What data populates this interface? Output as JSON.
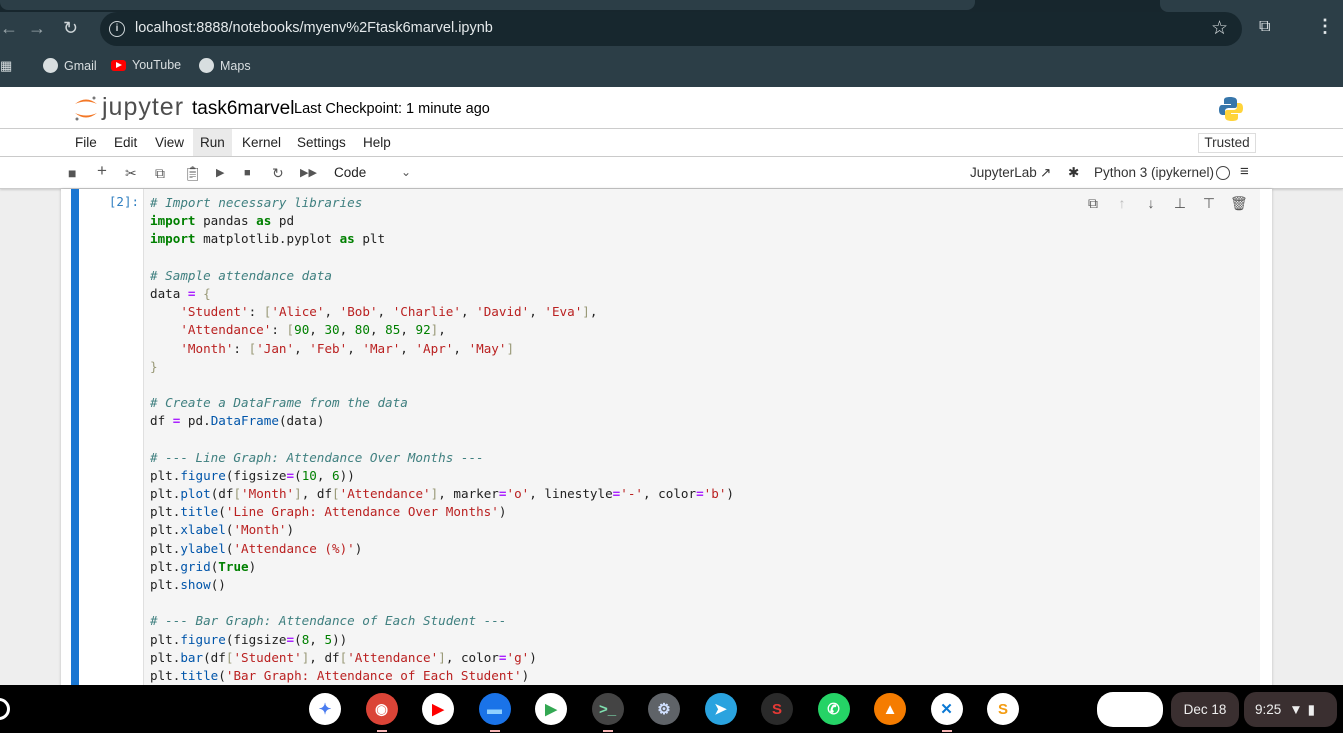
{
  "browser": {
    "url": "localhost:8888/notebooks/myenv%2Ftask6marvel.ipynb",
    "bookmarks": [
      {
        "label": "Gmail",
        "icon": "globe-icon"
      },
      {
        "label": "YouTube",
        "icon": "youtube-icon"
      },
      {
        "label": "Maps",
        "icon": "globe-icon"
      }
    ]
  },
  "jupyter": {
    "logo_text": "jupyter",
    "notebook_name": "task6marvel",
    "checkpoint": "Last Checkpoint: 1 minute ago",
    "menu": [
      "File",
      "Edit",
      "View",
      "Run",
      "Kernel",
      "Settings",
      "Help"
    ],
    "active_menu": "Run",
    "trusted": "Trusted",
    "cell_type": "Code",
    "jupyterlab_link": "JupyterLab",
    "kernel": "Python 3 (ipykernel)"
  },
  "cell": {
    "prompt": "[2]:",
    "lines": [
      [
        [
          "c",
          "# Import necessary libraries"
        ]
      ],
      [
        [
          "k",
          "import"
        ],
        [
          "n",
          " pandas "
        ],
        [
          "k",
          "as"
        ],
        [
          "n",
          " pd"
        ]
      ],
      [
        [
          "k",
          "import"
        ],
        [
          "n",
          " matplotlib.pyplot "
        ],
        [
          "k",
          "as"
        ],
        [
          "n",
          " plt"
        ]
      ],
      [],
      [
        [
          "c",
          "# Sample attendance data"
        ]
      ],
      [
        [
          "n",
          "data "
        ],
        [
          "o",
          "="
        ],
        [
          "n",
          " "
        ],
        [
          "b",
          "{"
        ]
      ],
      [
        [
          "n",
          "    "
        ],
        [
          "s",
          "'Student'"
        ],
        [
          "n",
          ": "
        ],
        [
          "b",
          "["
        ],
        [
          "s",
          "'Alice'"
        ],
        [
          "n",
          ", "
        ],
        [
          "s",
          "'Bob'"
        ],
        [
          "n",
          ", "
        ],
        [
          "s",
          "'Charlie'"
        ],
        [
          "n",
          ", "
        ],
        [
          "s",
          "'David'"
        ],
        [
          "n",
          ", "
        ],
        [
          "s",
          "'Eva'"
        ],
        [
          "b",
          "]"
        ],
        [
          "n",
          ","
        ]
      ],
      [
        [
          "n",
          "    "
        ],
        [
          "s",
          "'Attendance'"
        ],
        [
          "n",
          ": "
        ],
        [
          "b",
          "["
        ],
        [
          "m",
          "90"
        ],
        [
          "n",
          ", "
        ],
        [
          "m",
          "30"
        ],
        [
          "n",
          ", "
        ],
        [
          "m",
          "80"
        ],
        [
          "n",
          ", "
        ],
        [
          "m",
          "85"
        ],
        [
          "n",
          ", "
        ],
        [
          "m",
          "92"
        ],
        [
          "b",
          "]"
        ],
        [
          "n",
          ","
        ]
      ],
      [
        [
          "n",
          "    "
        ],
        [
          "s",
          "'Month'"
        ],
        [
          "n",
          ": "
        ],
        [
          "b",
          "["
        ],
        [
          "s",
          "'Jan'"
        ],
        [
          "n",
          ", "
        ],
        [
          "s",
          "'Feb'"
        ],
        [
          "n",
          ", "
        ],
        [
          "s",
          "'Mar'"
        ],
        [
          "n",
          ", "
        ],
        [
          "s",
          "'Apr'"
        ],
        [
          "n",
          ", "
        ],
        [
          "s",
          "'May'"
        ],
        [
          "b",
          "]"
        ]
      ],
      [
        [
          "b",
          "}"
        ]
      ],
      [],
      [
        [
          "c",
          "# Create a DataFrame from the data"
        ]
      ],
      [
        [
          "n",
          "df "
        ],
        [
          "o",
          "="
        ],
        [
          "n",
          " pd."
        ],
        [
          "f",
          "DataFrame"
        ],
        [
          "n",
          "(data)"
        ]
      ],
      [],
      [
        [
          "c",
          "# --- Line Graph: Attendance Over Months ---"
        ]
      ],
      [
        [
          "n",
          "plt."
        ],
        [
          "f",
          "figure"
        ],
        [
          "n",
          "(figsize"
        ],
        [
          "o",
          "="
        ],
        [
          "n",
          "("
        ],
        [
          "m",
          "10"
        ],
        [
          "n",
          ", "
        ],
        [
          "m",
          "6"
        ],
        [
          "n",
          "))"
        ]
      ],
      [
        [
          "n",
          "plt."
        ],
        [
          "f",
          "plot"
        ],
        [
          "n",
          "(df"
        ],
        [
          "b",
          "["
        ],
        [
          "s",
          "'Month'"
        ],
        [
          "b",
          "]"
        ],
        [
          "n",
          ", df"
        ],
        [
          "b",
          "["
        ],
        [
          "s",
          "'Attendance'"
        ],
        [
          "b",
          "]"
        ],
        [
          "n",
          ", marker"
        ],
        [
          "o",
          "="
        ],
        [
          "s",
          "'o'"
        ],
        [
          "n",
          ", linestyle"
        ],
        [
          "o",
          "="
        ],
        [
          "s",
          "'-'"
        ],
        [
          "n",
          ", color"
        ],
        [
          "o",
          "="
        ],
        [
          "s",
          "'b'"
        ],
        [
          "n",
          ")"
        ]
      ],
      [
        [
          "n",
          "plt."
        ],
        [
          "f",
          "title"
        ],
        [
          "n",
          "("
        ],
        [
          "s",
          "'Line Graph: Attendance Over Months'"
        ],
        [
          "n",
          ")"
        ]
      ],
      [
        [
          "n",
          "plt."
        ],
        [
          "f",
          "xlabel"
        ],
        [
          "n",
          "("
        ],
        [
          "s",
          "'Month'"
        ],
        [
          "n",
          ")"
        ]
      ],
      [
        [
          "n",
          "plt."
        ],
        [
          "f",
          "ylabel"
        ],
        [
          "n",
          "("
        ],
        [
          "s",
          "'Attendance (%)'"
        ],
        [
          "n",
          ")"
        ]
      ],
      [
        [
          "n",
          "plt."
        ],
        [
          "f",
          "grid"
        ],
        [
          "n",
          "("
        ],
        [
          "k",
          "True"
        ],
        [
          "n",
          ")"
        ]
      ],
      [
        [
          "n",
          "plt."
        ],
        [
          "f",
          "show"
        ],
        [
          "n",
          "()"
        ]
      ],
      [],
      [
        [
          "c",
          "# --- Bar Graph: Attendance of Each Student ---"
        ]
      ],
      [
        [
          "n",
          "plt."
        ],
        [
          "f",
          "figure"
        ],
        [
          "n",
          "(figsize"
        ],
        [
          "o",
          "="
        ],
        [
          "n",
          "("
        ],
        [
          "m",
          "8"
        ],
        [
          "n",
          ", "
        ],
        [
          "m",
          "5"
        ],
        [
          "n",
          "))"
        ]
      ],
      [
        [
          "n",
          "plt."
        ],
        [
          "f",
          "bar"
        ],
        [
          "n",
          "(df"
        ],
        [
          "b",
          "["
        ],
        [
          "s",
          "'Student'"
        ],
        [
          "b",
          "]"
        ],
        [
          "n",
          ", df"
        ],
        [
          "b",
          "["
        ],
        [
          "s",
          "'Attendance'"
        ],
        [
          "b",
          "]"
        ],
        [
          "n",
          ", color"
        ],
        [
          "o",
          "="
        ],
        [
          "s",
          "'g'"
        ],
        [
          "n",
          ")"
        ]
      ],
      [
        [
          "n",
          "plt."
        ],
        [
          "f",
          "title"
        ],
        [
          "n",
          "("
        ],
        [
          "s",
          "'Bar Graph: Attendance of Each Student'"
        ],
        [
          "n",
          ")"
        ]
      ]
    ]
  },
  "shelf": {
    "apps": [
      {
        "name": "gemini",
        "color": "#ffffff",
        "fg": "#4a7cf0",
        "glyph": "✦"
      },
      {
        "name": "chrome",
        "color": "#db4437",
        "fg": "#fff",
        "glyph": "◉",
        "open": true
      },
      {
        "name": "youtube",
        "color": "#ffffff",
        "fg": "#f00",
        "glyph": "▶"
      },
      {
        "name": "files",
        "color": "#1a73e8",
        "fg": "#8fd0ff",
        "glyph": "▬",
        "open": true
      },
      {
        "name": "play-store",
        "color": "#ffffff",
        "fg": "#34a853",
        "glyph": "▶"
      },
      {
        "name": "terminal",
        "color": "#444",
        "fg": "#7fe0b0",
        "glyph": ">_",
        "open": true
      },
      {
        "name": "settings",
        "color": "#5f6368",
        "fg": "#d0e0ff",
        "glyph": "⚙"
      },
      {
        "name": "telegram",
        "color": "#2aa3df",
        "fg": "#fff",
        "glyph": "➤"
      },
      {
        "name": "app-red",
        "color": "#2a2a2a",
        "fg": "#e53935",
        "glyph": "S"
      },
      {
        "name": "whatsapp",
        "color": "#25d366",
        "fg": "#fff",
        "glyph": "✆"
      },
      {
        "name": "vlc",
        "color": "#f57c00",
        "fg": "#fff",
        "glyph": "▲"
      },
      {
        "name": "vscode",
        "color": "#ffffff",
        "fg": "#0a78d4",
        "glyph": "✕",
        "open": true
      },
      {
        "name": "sublime",
        "color": "#ffffff",
        "fg": "#f39c12",
        "glyph": "S"
      }
    ],
    "date": "Dec 18",
    "time": "9:25"
  }
}
